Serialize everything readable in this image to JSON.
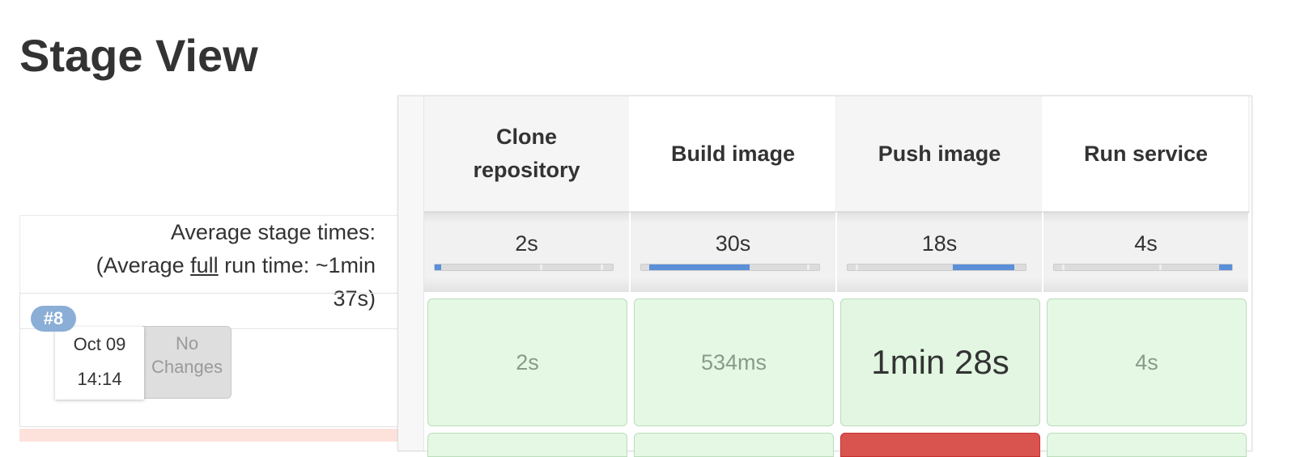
{
  "page": {
    "title": "Stage View"
  },
  "summary": {
    "line1": "Average stage times:",
    "line2_prefix": "(Average ",
    "line2_link": "full",
    "line2_suffix": " run time: ~1min",
    "line3": "37s)"
  },
  "run": {
    "badge": "#8",
    "date": "Oct 09",
    "time": "14:14",
    "changes_line1": "No",
    "changes_line2": "Changes"
  },
  "stages": [
    {
      "name": "Clone repository",
      "avg": "2s",
      "avg_fraction": 0.02,
      "cell": "2s",
      "highlight": false
    },
    {
      "name": "Build image",
      "avg": "30s",
      "avg_fraction": 0.31,
      "cell": "534ms",
      "highlight": false
    },
    {
      "name": "Push image",
      "avg": "18s",
      "avg_fraction": 0.19,
      "cell": "1min 28s",
      "highlight": true
    },
    {
      "name": "Run service",
      "avg": "4s",
      "avg_fraction": 0.04,
      "cell": "4s",
      "highlight": false
    }
  ],
  "colors": {
    "success_cell": "#e4f8e4",
    "success_border": "#bcdcbc",
    "progress_bar": "#5b8fd8",
    "badge": "#8aaed6",
    "failed": "#d9534f"
  }
}
